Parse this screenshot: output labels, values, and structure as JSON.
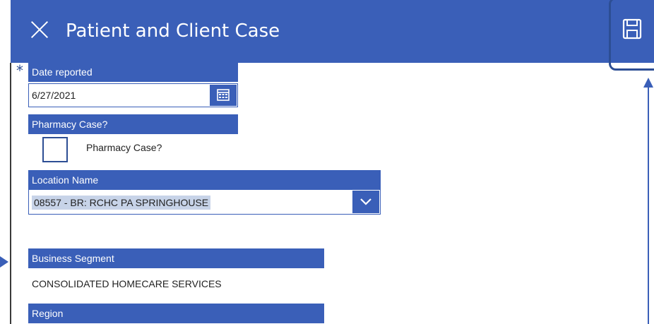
{
  "header": {
    "title": "Patient and Client Case",
    "close_icon": "close-icon",
    "save_icon": "save-icon"
  },
  "form": {
    "required_marker": "*",
    "date_reported": {
      "label": "Date reported",
      "value": "6/27/2021",
      "icon": "calendar-icon"
    },
    "pharmacy_case": {
      "label": "Pharmacy Case?",
      "checkbox_label": "Pharmacy Case?",
      "checked": false
    },
    "location_name": {
      "label": "Location Name",
      "value": "08557 - BR: RCHC PA SPRINGHOUSE",
      "icon": "chevron-down-icon"
    },
    "business_segment": {
      "label": "Business Segment",
      "value": "CONSOLIDATED HOMECARE SERVICES"
    },
    "region": {
      "label": "Region"
    }
  },
  "colors": {
    "accent": "#3a5fb8",
    "annotation": "#2d4e94",
    "selection": "#c7d3e8"
  }
}
